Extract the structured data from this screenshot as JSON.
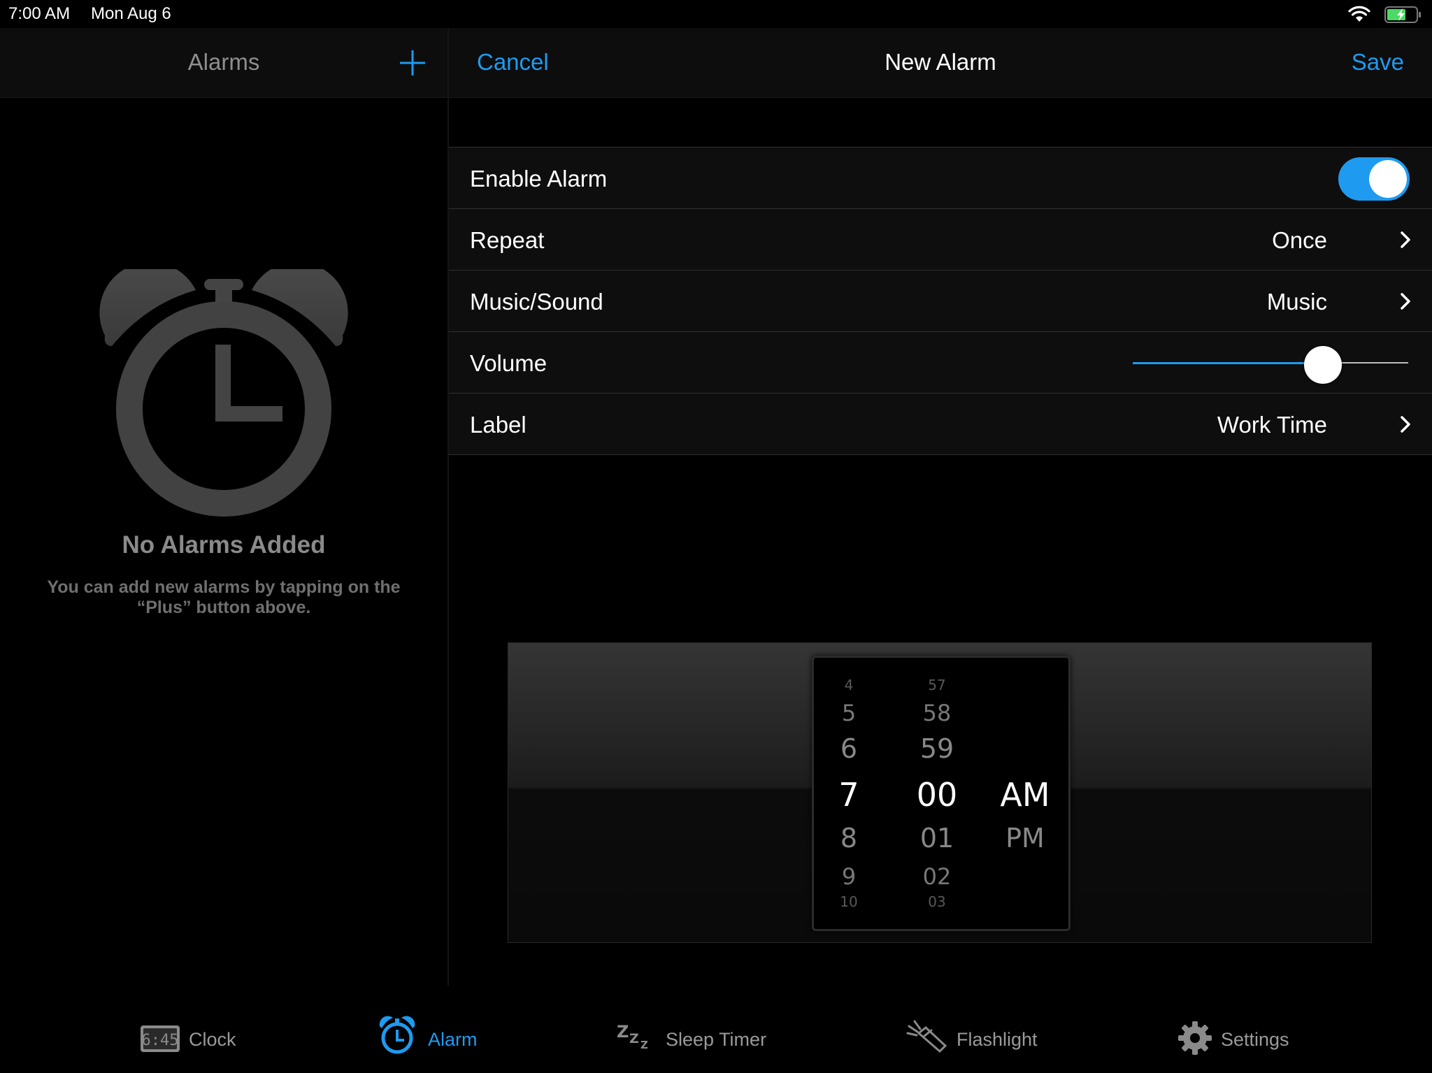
{
  "status_bar": {
    "time": "7:00 AM",
    "date": "Mon Aug 6"
  },
  "left_pane": {
    "title": "Alarms",
    "empty_title": "No Alarms Added",
    "empty_description": "You can add new alarms by tapping on the “Plus” button above."
  },
  "nav": {
    "cancel_label": "Cancel",
    "title": "New Alarm",
    "save_label": "Save"
  },
  "settings": {
    "enable_alarm": {
      "label": "Enable Alarm",
      "enabled": true
    },
    "repeat": {
      "label": "Repeat",
      "value": "Once"
    },
    "music_sound": {
      "label": "Music/Sound",
      "value": "Music"
    },
    "volume": {
      "label": "Volume",
      "level": 0.72
    },
    "label": {
      "label": "Label",
      "value": "Work Time"
    }
  },
  "picker": {
    "hours": [
      "4",
      "5",
      "6",
      "7",
      "8",
      "9",
      "10"
    ],
    "minutes": [
      "57",
      "58",
      "59",
      "00",
      "01",
      "02",
      "03"
    ],
    "periods": [
      "AM",
      "PM"
    ],
    "selected_hour": "7",
    "selected_minute": "00",
    "selected_period": "AM"
  },
  "tab_bar": {
    "clock_icon_text": "6:45",
    "tabs": [
      {
        "label": "Clock",
        "icon": "clock-display-icon"
      },
      {
        "label": "Alarm",
        "icon": "alarm-clock-icon",
        "active": true
      },
      {
        "label": "Sleep Timer",
        "icon": "zzz-icon"
      },
      {
        "label": "Flashlight",
        "icon": "flashlight-icon"
      },
      {
        "label": "Settings",
        "icon": "gear-icon"
      }
    ]
  },
  "colors": {
    "accent": "#1e9bf0",
    "background": "#000000",
    "row_background": "#0e0e0e"
  }
}
